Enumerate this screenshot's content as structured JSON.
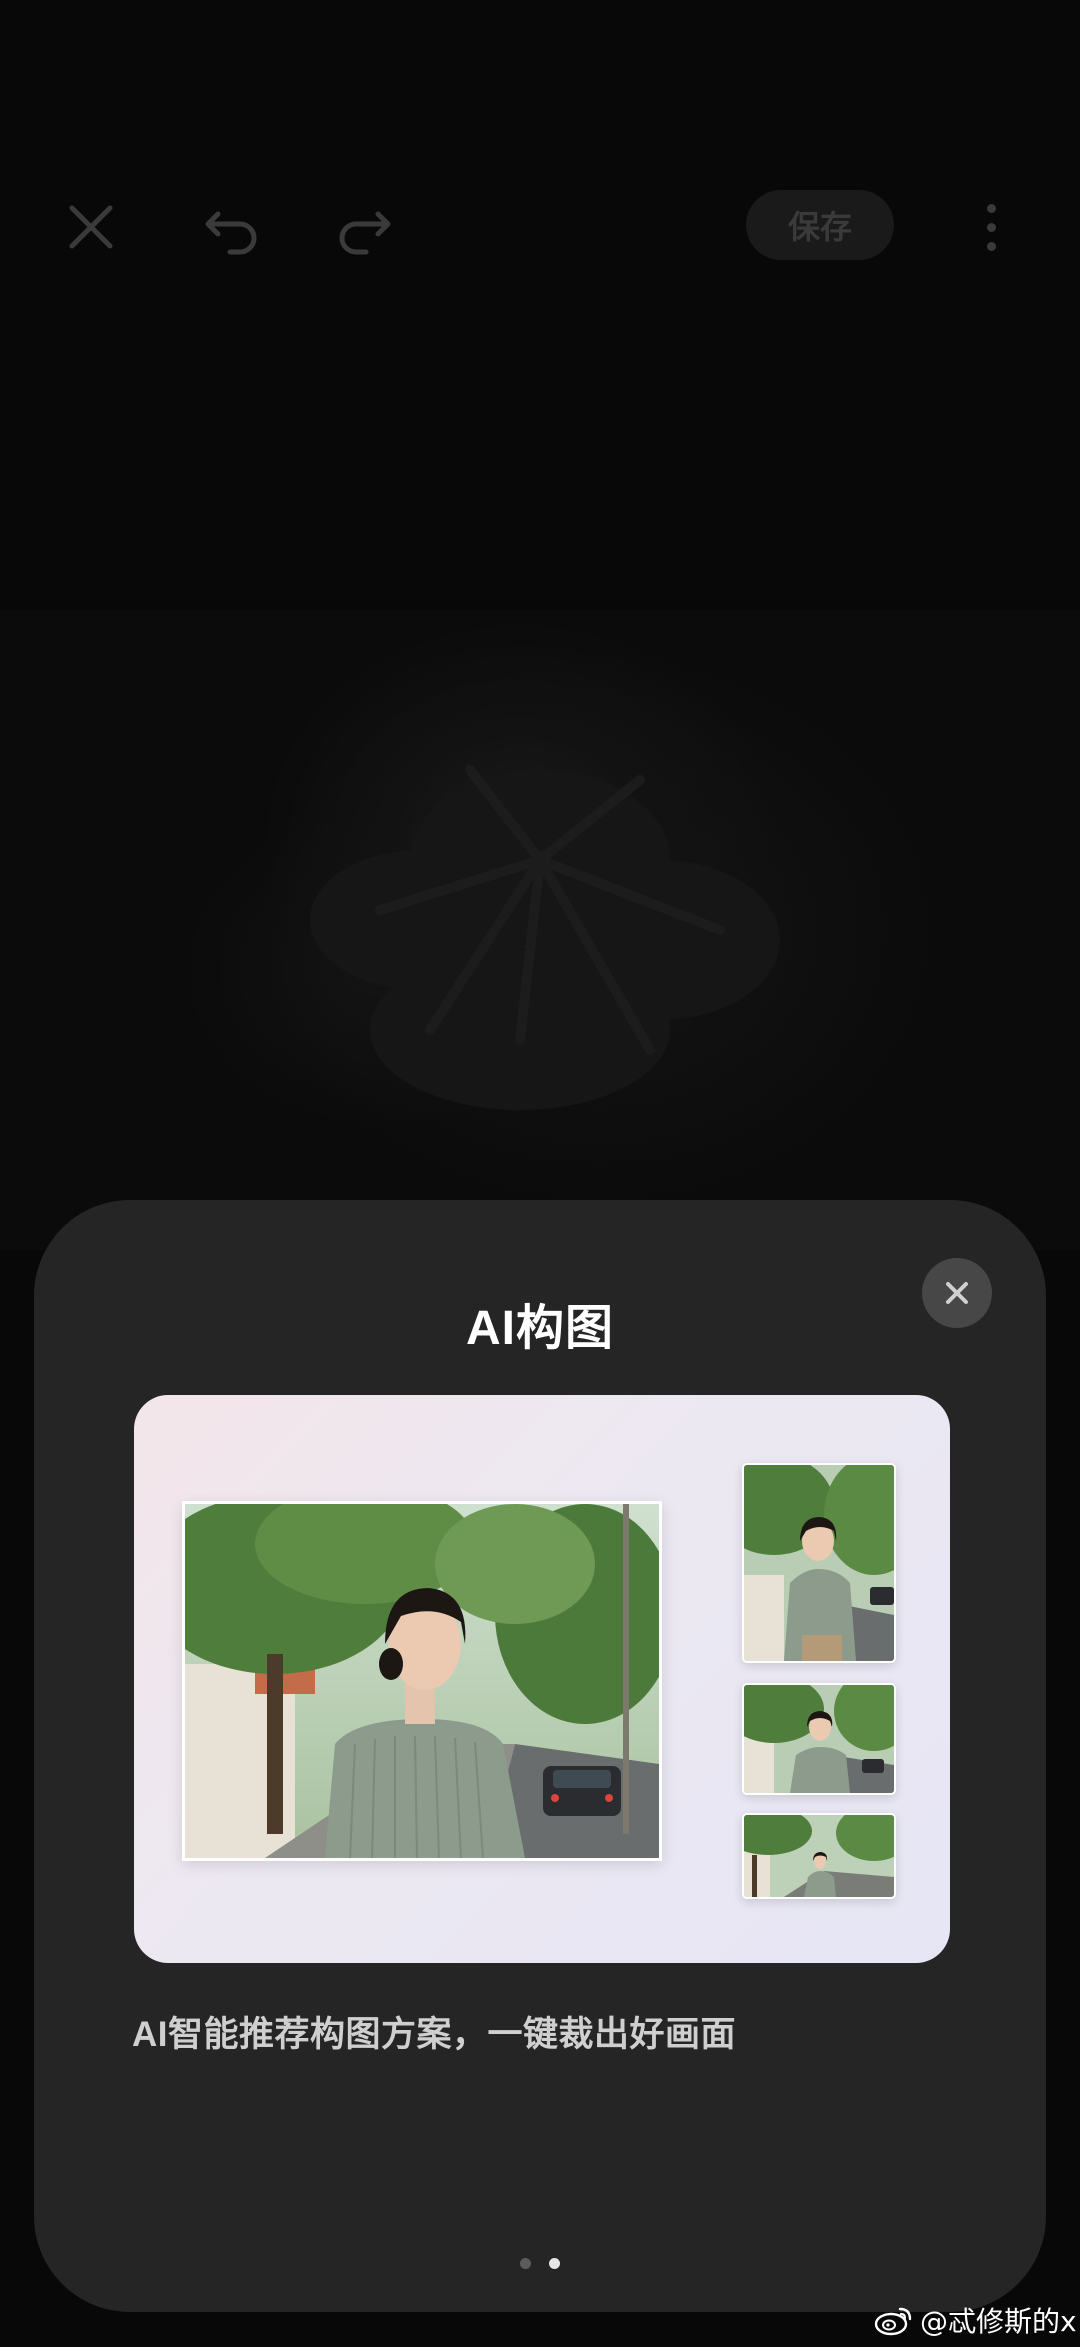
{
  "editor": {
    "save_label": "保存"
  },
  "modal": {
    "title": "AI构图",
    "description": "AI智能推荐构图方案，一键裁出好画面",
    "pager": {
      "total": 2,
      "current": 2
    }
  },
  "watermark": {
    "text": "@忒修斯的x"
  },
  "colors": {
    "sheet_bg": "#252525",
    "card_gradient_start": "#f3e6ea",
    "card_gradient_end": "#e6e6f4",
    "close_button_bg": "#474747",
    "pager_active": "#e6e6e6",
    "pager_inactive": "#5c5c5c"
  },
  "icons": {
    "close": "close-icon",
    "undo": "undo-icon",
    "redo": "redo-icon",
    "more": "more-vertical-icon",
    "watermark": "weibo-icon"
  }
}
